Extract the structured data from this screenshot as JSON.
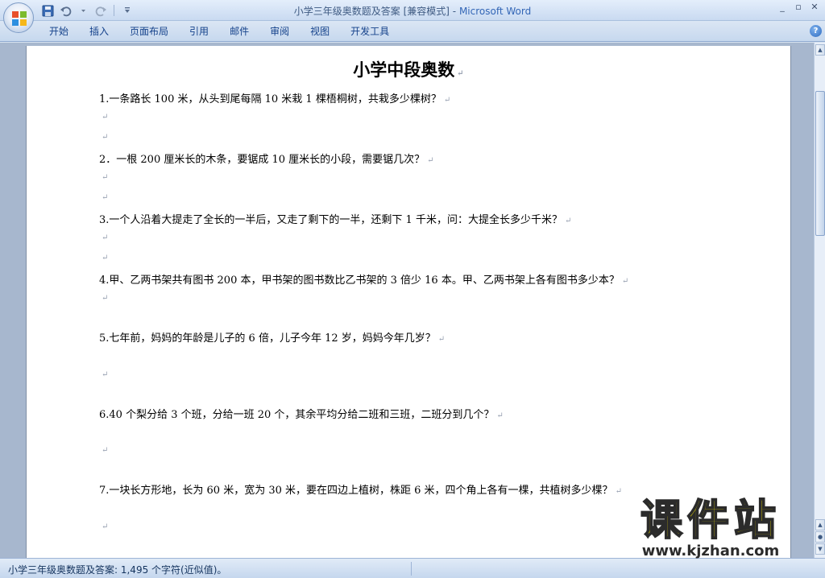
{
  "window": {
    "title": "小学三年级奥数题及答案 [兼容模式]",
    "title_sep": " - ",
    "app_name": "Microsoft Word",
    "controls": [
      "_",
      "▫",
      "✕"
    ]
  },
  "ribbon": {
    "tabs": [
      "开始",
      "插入",
      "页面布局",
      "引用",
      "邮件",
      "审阅",
      "视图",
      "开发工具"
    ],
    "help_label": "?"
  },
  "document": {
    "title": "小学中段奥数",
    "paragraph_mark": "↵",
    "lines": [
      "1.一条路长 100 米，从头到尾每隔 10 米栽 1 棵梧桐树，共栽多少棵树？",
      "2．一根 200 厘米长的木条，要锯成 10 厘米长的小段，需要锯几次？",
      "3.一个人沿着大提走了全长的一半后，又走了剩下的一半，还剩下 1 千米，问：大提全长多少千米？",
      "4.甲、乙两书架共有图书 200 本，甲书架的图书数比乙书架的 3 倍少 16 本。甲、乙两书架上各有图书多少本？",
      "5.七年前，妈妈的年龄是儿子的 6 倍，儿子今年 12 岁，妈妈今年几岁？",
      "6.40 个梨分给 3 个班，分给一班 20 个，其余平均分给二班和三班，二班分到几个？",
      "7.一块长方形地，长为 60 米，宽为 30 米，要在四边上植树，株距 6 米，四个角上各有一棵，共植树多少棵？"
    ]
  },
  "statusbar": {
    "text": "小学三年级奥数题及答案: 1,495 个字符(近似值)。"
  },
  "watermark": {
    "text": "课件站",
    "url": "www.kjzhan.com"
  },
  "colors": {
    "ribbon_text": "#15428b",
    "title_app": "#3366b6",
    "page_bg": "#ffffff",
    "doc_bg": "#a7b7ce",
    "watermark": "#f3e200"
  }
}
